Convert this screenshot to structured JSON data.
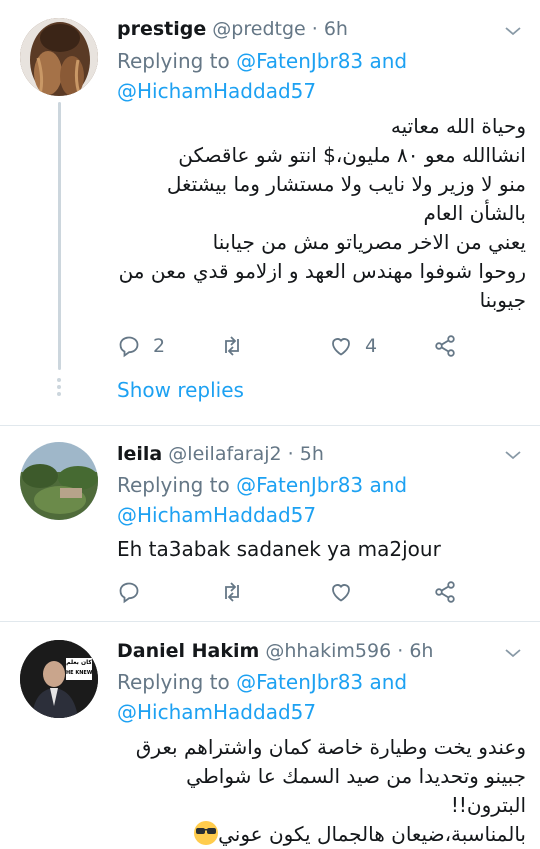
{
  "tweets": [
    {
      "name": "prestige",
      "handle": "@predtge",
      "sep": "·",
      "time": "6h",
      "replying_prefix": "Replying to ",
      "mention1": "@FatenJbr83",
      "and": " and",
      "mention2": "@HichamHaddad57",
      "body_lines": [
        "وحياة الله معاتيه",
        "انشاالله معو ٨٠ مليون،$ انتو شو عاقصكن",
        "منو لا وزير ولا نايب ولا مستشار وما بيشتغل بالشأن العام",
        "يعني من الاخر مصرياتو مش من جيابنا",
        "روحوا شوفوا مهندس العهد و ازلامو قدي معن من جيوبنا"
      ],
      "reply_count": "2",
      "retweet_count": "",
      "like_count": "4",
      "show_replies": "Show replies"
    },
    {
      "name": "leila",
      "handle": "@leilafaraj2",
      "sep": "·",
      "time": "5h",
      "replying_prefix": "Replying to ",
      "mention1": "@FatenJbr83",
      "and": " and",
      "mention2": "@HichamHaddad57",
      "body_text": "Eh ta3abak sadanek ya ma2jour",
      "reply_count": "",
      "retweet_count": "",
      "like_count": ""
    },
    {
      "name": "Daniel Hakim",
      "handle": "@hhakim596",
      "sep": "·",
      "time": "6h",
      "replying_prefix": "Replying to ",
      "mention1": "@FatenJbr83",
      "and": " and",
      "mention2": "@HichamHaddad57",
      "body_lines": [
        "وعندو يخت وطيارة خاصة كمان واشتراهم بعرق",
        "جبينو وتحديدا من صيد السمك عا شواطي البترون!!",
        "بالمناسبة،ضيعان هالجمال يكون عوني"
      ],
      "avatar_caption_ar": "كان بعلم",
      "avatar_caption_en": "HE KNEW"
    }
  ],
  "colors": {
    "accent": "#1da1f2",
    "secondary_text": "#657786",
    "divider": "#e1e8ed",
    "thread_line": "#ccd6dd"
  },
  "icons": [
    "reply-icon",
    "retweet-icon",
    "like-icon",
    "share-icon",
    "chevron-down-icon",
    "sunglasses-emoji-icon"
  ]
}
